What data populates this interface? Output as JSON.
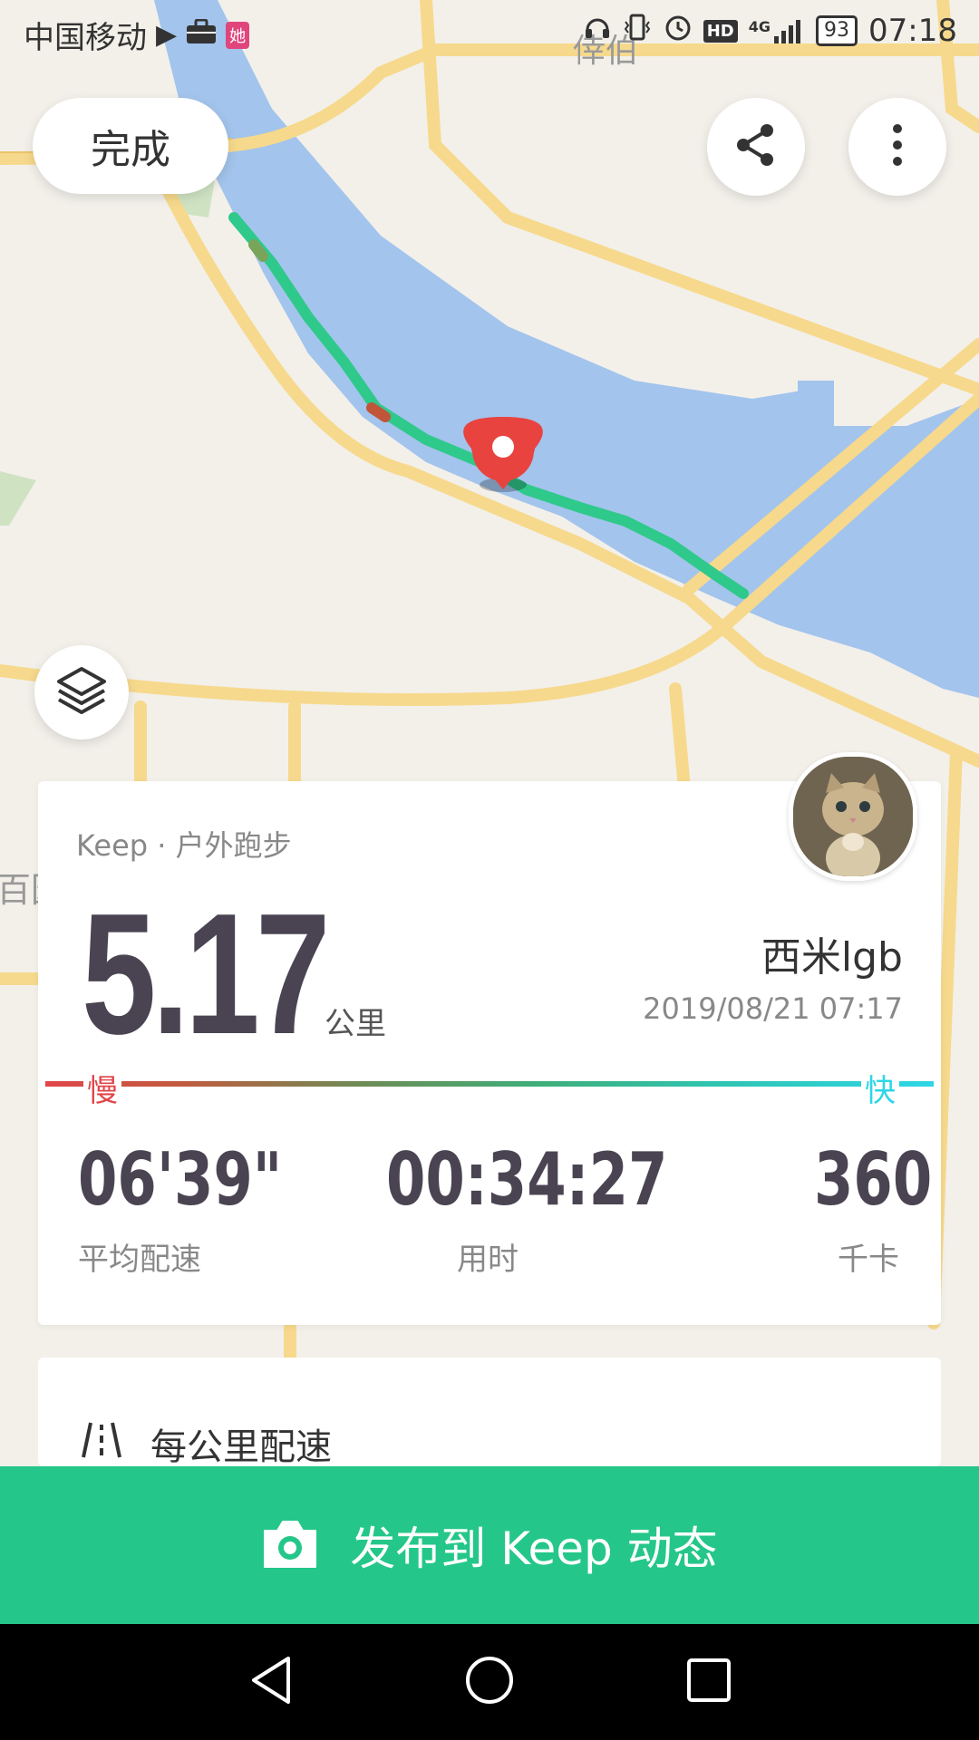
{
  "status_bar": {
    "carrier": "中国移动",
    "battery": "93",
    "network": "4G",
    "hd": "HD",
    "time": "07:18",
    "app_badge": "她"
  },
  "map": {
    "place_label": "倖伯",
    "left_label": "百园"
  },
  "top_controls": {
    "done_label": "完成"
  },
  "summary_card": {
    "source": "Keep · 户外跑步",
    "distance": "5.17",
    "distance_unit": "公里",
    "username": "西米lgb",
    "datetime": "2019/08/21 07:17",
    "slow_label": "慢",
    "fast_label": "快",
    "stats": [
      {
        "value": "06'39\"",
        "label": "平均配速"
      },
      {
        "value": "00:34:27",
        "label": "用时"
      },
      {
        "value": "360",
        "label": "千卡"
      }
    ]
  },
  "pace_card": {
    "title": "每公里配速"
  },
  "publish": {
    "label": "发布到 Keep 动态"
  },
  "colors": {
    "brand_green": "#24c789",
    "slow": "#e0464a",
    "fast": "#2ed6e6",
    "water": "#a3c4ec"
  }
}
